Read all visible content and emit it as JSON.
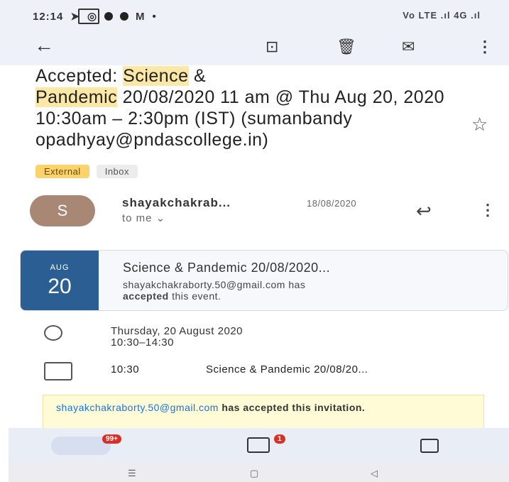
{
  "status_bar": {
    "time": "12:14",
    "right": "Vo LTE .ıl 4G .ıl"
  },
  "toolbar": {
    "back_icon": "arrow-left-icon",
    "archive_icon": "archive-icon",
    "delete_icon": "trash-icon",
    "mark_unread_icon": "mail-icon",
    "more_icon": "more-vert-icon"
  },
  "subject": {
    "pre": "Accepted: ",
    "hl1": "Science",
    "mid1": " &",
    "hl2": "Pandemic",
    "rest": " 20/08/2020 11 am @ Thu Aug 20, 2020 10:30am – 2:30pm (IST) (sumanbandy opadhyay@pndascollege.in)"
  },
  "labels": [
    "External",
    "Inbox"
  ],
  "sender": {
    "initial": "S",
    "name": "shayakchakrab...",
    "date": "18/08/2020",
    "to": "to me ⌄"
  },
  "event": {
    "month": "AUG",
    "day": "20",
    "title": "Science & Pandemic 20/08/2020...",
    "line1": "shayakchakraborty.50@gmail.com has",
    "line2_bold": "accepted",
    "line2_rest": " this event."
  },
  "details": {
    "date_line": "Thursday, 20 August 2020",
    "time_range": "10:30–14:30",
    "agenda_time": "10:30",
    "agenda_title": "Science & Pandemic 20/08/20..."
  },
  "invite": {
    "email": "shayakchakraborty.50@gmail.com",
    "text": " has accepted this invitation."
  },
  "bottom_nav": {
    "mail_badge": "99+",
    "chat_badge": "1"
  },
  "colors": {
    "highlight": "#fce8a6",
    "calendar_blue": "#2b5f94",
    "badge_red": "#d93025",
    "chip_external": "#fbd26b"
  }
}
